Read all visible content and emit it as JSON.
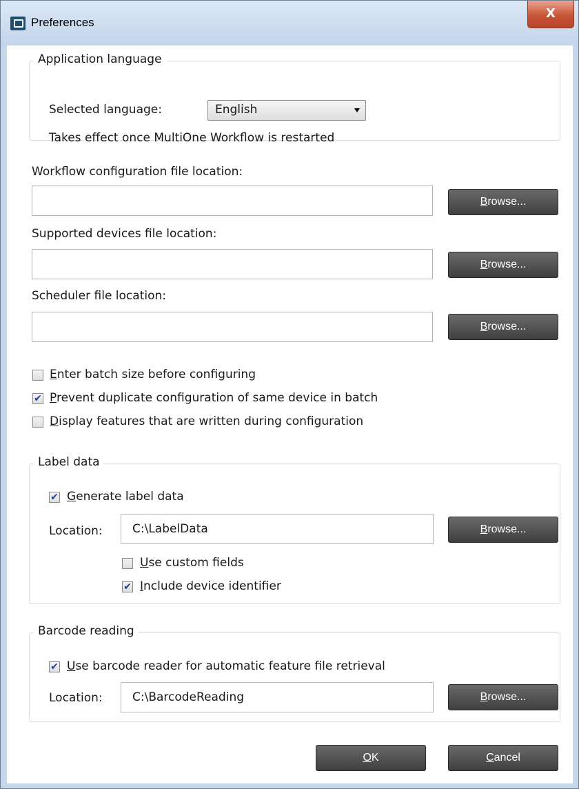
{
  "window": {
    "title": "Preferences",
    "close_glyph": "X"
  },
  "language_group": {
    "legend": "Application language",
    "selected_label": "Selected language:",
    "selected_value": "English",
    "note": "Takes effect once MultiOne Workflow is restarted"
  },
  "files": {
    "workflow_label": "Workflow configuration file location:",
    "workflow_value": "",
    "devices_label": "Supported devices file location:",
    "devices_value": "",
    "scheduler_label": "Scheduler file location:",
    "scheduler_value": ""
  },
  "browse": {
    "mnemonic": "B",
    "rest": "rowse..."
  },
  "options": [
    {
      "mnemonic": "E",
      "rest": "nter batch size before configuring",
      "checked": false
    },
    {
      "mnemonic": "P",
      "rest": "revent duplicate configuration of same device in batch",
      "checked": true
    },
    {
      "mnemonic": "D",
      "rest": "isplay features that are written during configuration",
      "checked": false
    }
  ],
  "label_data": {
    "legend": "Label data",
    "generate": {
      "mnemonic": "G",
      "rest": "enerate label data",
      "checked": true
    },
    "location_label": "Location:",
    "location_value": "C:\\LabelData",
    "custom_fields": {
      "mnemonic": "U",
      "rest": "se custom fields",
      "checked": false
    },
    "device_id": {
      "mnemonic": "I",
      "rest": "nclude device identifier",
      "checked": true
    }
  },
  "barcode": {
    "legend": "Barcode reading",
    "use_reader": {
      "mnemonic": "U",
      "rest": "se barcode reader for automatic feature file retrieval",
      "checked": true
    },
    "location_label": "Location:",
    "location_value": "C:\\BarcodeReading"
  },
  "footer": {
    "ok_mnemonic": "O",
    "ok_rest": "K",
    "cancel_mnemonic": "C",
    "cancel_rest": "ancel"
  },
  "colors": {
    "button_bg": "#4f4f4f",
    "check_mark": "#1c3f94",
    "frame": "#c7d8ec",
    "close_button": "#c95537"
  }
}
